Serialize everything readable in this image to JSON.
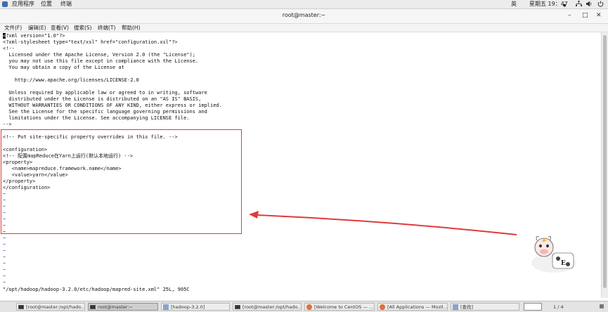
{
  "topbar": {
    "apps": "应用程序",
    "places": "位置",
    "terminal": "终端",
    "lang": "英",
    "clock": "星期五 19：47",
    "clock_dot": "●"
  },
  "window": {
    "title": "root@master:~",
    "minimize": "–",
    "maximize": "□",
    "close": "✕"
  },
  "menu": [
    "文件(F)",
    "编辑(E)",
    "查看(V)",
    "搜索(S)",
    "终端(T)",
    "帮助(H)"
  ],
  "editor": {
    "first_char": "<",
    "lines": [
      "?xml version=\"1.0\"?>",
      "<?xml-stylesheet type=\"text/xsl\" href=\"configuration.xsl\"?>",
      "<!--",
      "  Licensed under the Apache License, Version 2.0 (the \"License\");",
      "  you may not use this file except in compliance with the License.",
      "  You may obtain a copy of the License at",
      "",
      "    http://www.apache.org/licenses/LICENSE-2.0",
      "",
      "  Unless required by applicable law or agreed to in writing, software",
      "  distributed under the License is distributed on an \"AS IS\" BASIS,",
      "  WITHOUT WARRANTIES OR CONDITIONS OF ANY KIND, either express or implied.",
      "  See the License for the specific language governing permissions and",
      "  limitations under the License. See accompanying LICENSE file.",
      "-->",
      "",
      "<!-- Put site-specific property overrides in this file. -->",
      "",
      "<configuration>",
      "<!-- 配置mapReduce在Yarn上运行(默认本地运行) -->",
      "<property>",
      "   <name>mapreduce.framework.name</name>",
      "   <value>yarn</value>",
      "</property>",
      "</configuration>"
    ],
    "tilde": "~",
    "status": "\"/opt/hadoop/hadoop-3.2.0/etc/hadoop/mapred-site.xml\" 25L, 905C"
  },
  "colors": {
    "highlight": "#e03a3a",
    "arrow": "#e03a3a",
    "tilde": "#2a3ea8"
  },
  "taskbar": {
    "items": [
      "[root@master:/opt/hado...",
      "root@master:~",
      "[hadoop-3.2.0]",
      "[root@master:/opt/hado...",
      "[Welcome to CentOS — ...",
      "[All Applications — Mozil...",
      "[查找]"
    ],
    "pager": "1 / 4"
  }
}
